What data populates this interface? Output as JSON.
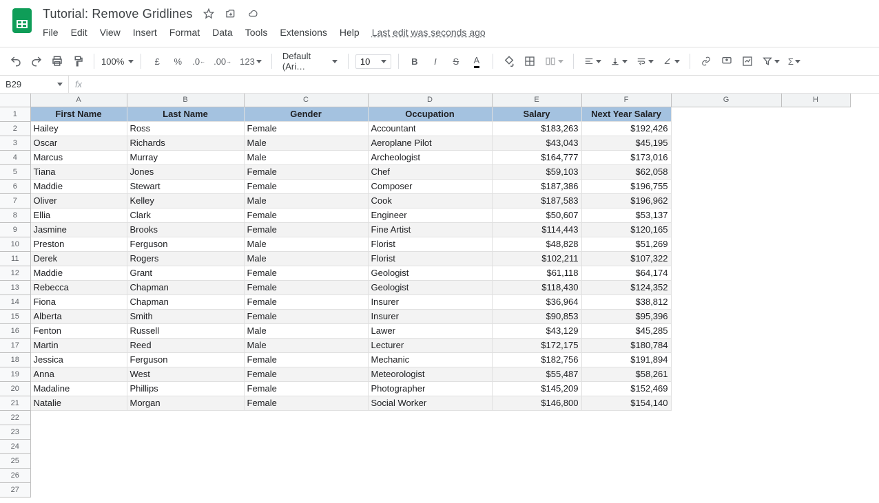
{
  "doc": {
    "title": "Tutorial: Remove Gridlines",
    "last_edit": "Last edit was seconds ago"
  },
  "menus": [
    "File",
    "Edit",
    "View",
    "Insert",
    "Format",
    "Data",
    "Tools",
    "Extensions",
    "Help"
  ],
  "toolbar": {
    "zoom": "100%",
    "font": "Default (Ari…",
    "size": "10",
    "format_number": "123"
  },
  "formula": {
    "namebox": "B29",
    "value": ""
  },
  "columns": [
    "A",
    "B",
    "C",
    "D",
    "E",
    "F",
    "G",
    "H"
  ],
  "headers": [
    "First Name",
    "Last Name",
    "Gender",
    "Occupation",
    "Salary",
    "Next Year Salary"
  ],
  "rows": [
    [
      "Hailey",
      "Ross",
      "Female",
      "Accountant",
      "$183,263",
      "$192,426"
    ],
    [
      "Oscar",
      "Richards",
      "Male",
      "Aeroplane Pilot",
      "$43,043",
      "$45,195"
    ],
    [
      "Marcus",
      "Murray",
      "Male",
      "Archeologist",
      "$164,777",
      "$173,016"
    ],
    [
      "Tiana",
      "Jones",
      "Female",
      "Chef",
      "$59,103",
      "$62,058"
    ],
    [
      "Maddie",
      "Stewart",
      "Female",
      "Composer",
      "$187,386",
      "$196,755"
    ],
    [
      "Oliver",
      "Kelley",
      "Male",
      "Cook",
      "$187,583",
      "$196,962"
    ],
    [
      "Ellia",
      "Clark",
      "Female",
      "Engineer",
      "$50,607",
      "$53,137"
    ],
    [
      "Jasmine",
      "Brooks",
      "Female",
      "Fine Artist",
      "$114,443",
      "$120,165"
    ],
    [
      "Preston",
      "Ferguson",
      "Male",
      "Florist",
      "$48,828",
      "$51,269"
    ],
    [
      "Derek",
      "Rogers",
      "Male",
      "Florist",
      "$102,211",
      "$107,322"
    ],
    [
      "Maddie",
      "Grant",
      "Female",
      "Geologist",
      "$61,118",
      "$64,174"
    ],
    [
      "Rebecca",
      "Chapman",
      "Female",
      "Geologist",
      "$118,430",
      "$124,352"
    ],
    [
      "Fiona",
      "Chapman",
      "Female",
      "Insurer",
      "$36,964",
      "$38,812"
    ],
    [
      "Alberta",
      "Smith",
      "Female",
      "Insurer",
      "$90,853",
      "$95,396"
    ],
    [
      "Fenton",
      "Russell",
      "Male",
      "Lawer",
      "$43,129",
      "$45,285"
    ],
    [
      "Martin",
      "Reed",
      "Male",
      "Lecturer",
      "$172,175",
      "$180,784"
    ],
    [
      "Jessica",
      "Ferguson",
      "Female",
      "Mechanic",
      "$182,756",
      "$191,894"
    ],
    [
      "Anna",
      "West",
      "Female",
      "Meteorologist",
      "$55,487",
      "$58,261"
    ],
    [
      "Madaline",
      "Phillips",
      "Female",
      "Photographer",
      "$145,209",
      "$152,469"
    ],
    [
      "Natalie",
      "Morgan",
      "Female",
      "Social Worker",
      "$146,800",
      "$154,140"
    ]
  ],
  "blank_rows": 6
}
